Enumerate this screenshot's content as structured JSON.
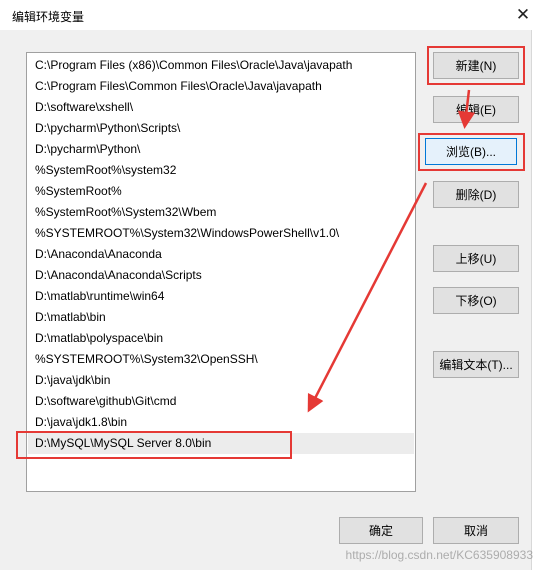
{
  "window": {
    "title": "编辑环境变量",
    "close_glyph": "✕"
  },
  "paths": [
    "C:\\Program Files (x86)\\Common Files\\Oracle\\Java\\javapath",
    "C:\\Program Files\\Common Files\\Oracle\\Java\\javapath",
    "D:\\software\\xshell\\",
    "D:\\pycharm\\Python\\Scripts\\",
    "D:\\pycharm\\Python\\",
    "%SystemRoot%\\system32",
    "%SystemRoot%",
    "%SystemRoot%\\System32\\Wbem",
    "%SYSTEMROOT%\\System32\\WindowsPowerShell\\v1.0\\",
    "D:\\Anaconda\\Anaconda",
    "D:\\Anaconda\\Anaconda\\Scripts",
    "D:\\matlab\\runtime\\win64",
    "D:\\matlab\\bin",
    "D:\\matlab\\polyspace\\bin",
    "%SYSTEMROOT%\\System32\\OpenSSH\\",
    "D:\\java\\jdk\\bin",
    "D:\\software\\github\\Git\\cmd",
    "D:\\java\\jdk1.8\\bin",
    "D:\\MySQL\\MySQL Server 8.0\\bin"
  ],
  "buttons": {
    "new": "新建(N)",
    "edit": "编辑(E)",
    "browse": "浏览(B)...",
    "delete": "删除(D)",
    "move_up": "上移(U)",
    "move_down": "下移(O)",
    "edit_text": "编辑文本(T)...",
    "ok": "确定",
    "cancel": "取消"
  },
  "watermark": "https://blog.csdn.net/KC635908933",
  "colors": {
    "annotation": "#e53935",
    "selection": "#ececec",
    "focus": "#0078d7"
  }
}
